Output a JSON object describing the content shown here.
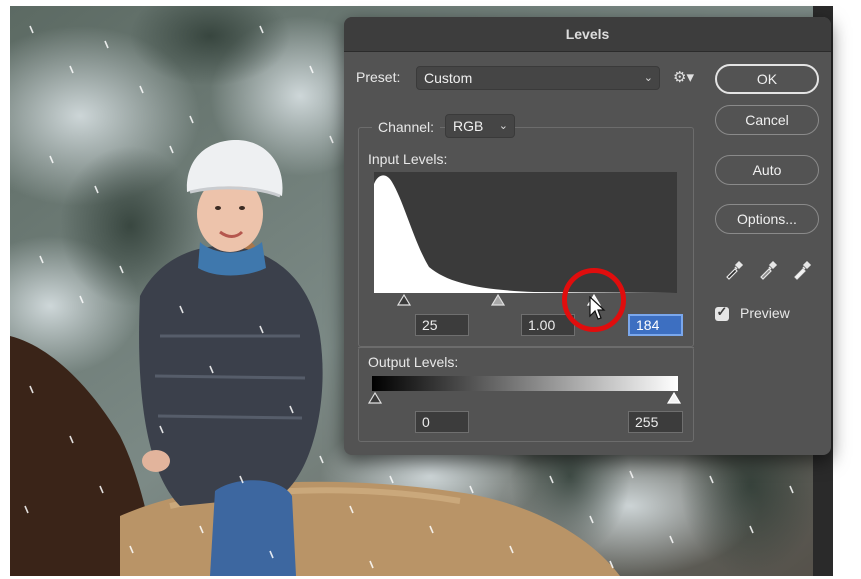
{
  "dialog": {
    "title": "Levels",
    "preset": {
      "label": "Preset:",
      "value": "Custom",
      "settings_icon": "gear-icon"
    },
    "channel": {
      "label": "Channel:",
      "value": "RGB"
    },
    "input_levels": {
      "label": "Input Levels:",
      "black": "25",
      "midtone": "1.00",
      "white": "184"
    },
    "output_levels": {
      "label": "Output Levels:",
      "black": "0",
      "white": "255"
    },
    "buttons": {
      "ok": "OK",
      "cancel": "Cancel",
      "auto": "Auto",
      "options": "Options..."
    },
    "eyedroppers": [
      "black-eyedropper-icon",
      "gray-eyedropper-icon",
      "white-eyedropper-icon"
    ],
    "preview": {
      "label": "Preview",
      "checked": true
    }
  },
  "annotation": {
    "color": "#e00d0d"
  }
}
